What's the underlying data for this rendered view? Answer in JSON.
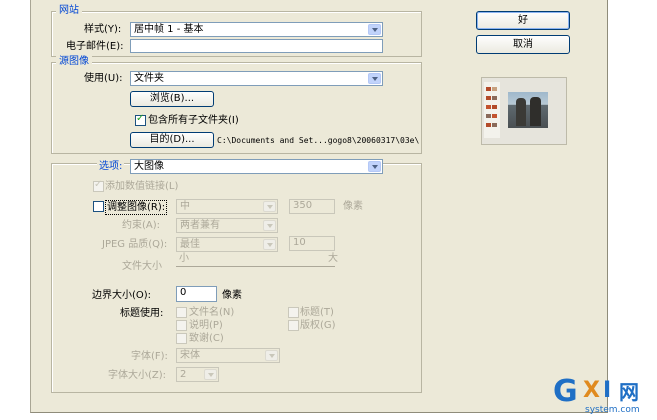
{
  "site_group": {
    "legend": "网站",
    "style_label": "样式(Y):",
    "style_value": "居中帧 1 - 基本",
    "email_label": "电子邮件(E):",
    "email_value": ""
  },
  "source_group": {
    "legend": "源图像",
    "use_label": "使用(U):",
    "use_value": "文件夹",
    "browse_label": "浏览(B)...",
    "include_subfolders_label": "包含所有子文件夹(I)",
    "include_subfolders_checked": true,
    "destination_label": "目的(D)...",
    "destination_path": "C:\\Documents and Set...gogo8\\20060317\\03e\\"
  },
  "options_group": {
    "options_label": "选项:",
    "options_value": "大图像",
    "add_numeric_links_label": "添加数值链接(L)",
    "add_numeric_links_checked": true,
    "resize_label": "调整图像(R):",
    "resize_checked": false,
    "resize_size_value": "中",
    "resize_pixels_value": "350",
    "resize_pixels_unit": "像素",
    "constrain_label": "约束(A):",
    "constrain_value": "两者兼有",
    "jpeg_quality_label": "JPEG 品质(Q):",
    "jpeg_quality_value": "最佳",
    "jpeg_quality_number": "10",
    "file_size_label": "文件大小",
    "file_size_small": "小",
    "file_size_large": "大",
    "border_size_label": "边界大小(O):",
    "border_size_value": "0",
    "border_size_unit": "像素",
    "titles_use_label": "标题使用:",
    "title_checkboxes": {
      "filename": "文件名(N)",
      "title": "标题(T)",
      "caption": "说明(P)",
      "copyright": "版权(G)",
      "credits": "致谢(C)"
    },
    "font_label": "字体(F):",
    "font_value": "宋体",
    "font_size_label": "字体大小(Z):",
    "font_size_value": "2"
  },
  "buttons": {
    "ok": "好",
    "cancel": "取消"
  },
  "watermark": {
    "brand_g": "G",
    "brand_x": "X",
    "brand_i": "I",
    "brand_cn": "网",
    "url": "system.com"
  },
  "colors": {
    "dialog_bg": "#ece9d8",
    "legend_text": "#0046d5",
    "disabled_text": "#aca899",
    "watermark_blue": "#1f6fc5"
  }
}
